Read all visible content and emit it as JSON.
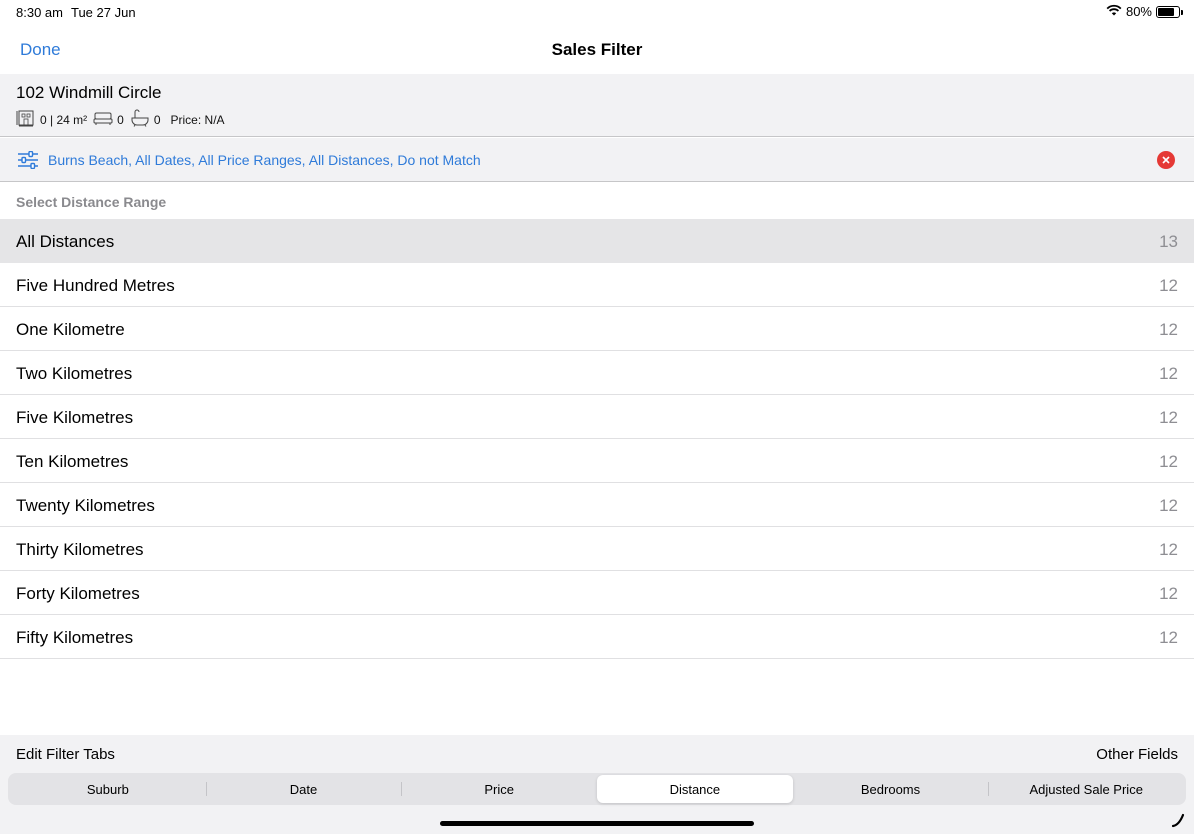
{
  "status_bar": {
    "time": "8:30 am",
    "date": "Tue 27 Jun",
    "battery_text": "80%",
    "battery_level": 0.8
  },
  "nav": {
    "done_label": "Done",
    "title": "Sales Filter"
  },
  "property": {
    "address": "102 Windmill Circle",
    "land": "0 | 24 m²",
    "bedrooms": "0",
    "bathrooms": "0",
    "price": "Price: N/A"
  },
  "filter_summary": {
    "text": "Burns Beach, All Dates, All Price Ranges, All Distances, Do not Match"
  },
  "section_header": "Select Distance Range",
  "distances": [
    {
      "label": "All Distances",
      "count": "13",
      "selected": true
    },
    {
      "label": "Five Hundred Metres",
      "count": "12"
    },
    {
      "label": "One Kilometre",
      "count": "12"
    },
    {
      "label": "Two Kilometres",
      "count": "12"
    },
    {
      "label": "Five Kilometres",
      "count": "12"
    },
    {
      "label": "Ten Kilometres",
      "count": "12"
    },
    {
      "label": "Twenty Kilometres",
      "count": "12"
    },
    {
      "label": "Thirty Kilometres",
      "count": "12"
    },
    {
      "label": "Forty Kilometres",
      "count": "12"
    },
    {
      "label": "Fifty Kilometres",
      "count": "12"
    }
  ],
  "bottom": {
    "edit_tabs_label": "Edit Filter Tabs",
    "other_fields_label": "Other Fields"
  },
  "tabs": [
    "Suburb",
    "Date",
    "Price",
    "Distance",
    "Bedrooms",
    "Adjusted Sale Price"
  ],
  "active_tab": "Distance",
  "colors": {
    "accent": "#2f7bd9",
    "clear": "#e53935",
    "selected_row": "#e5e5e7"
  },
  "icons": {
    "wifi": "wifi-icon",
    "battery": "battery-icon",
    "land": "land-size-icon",
    "bed": "bed-icon",
    "bath": "bath-icon",
    "filter": "sliders-icon",
    "clear": "clear-icon"
  }
}
